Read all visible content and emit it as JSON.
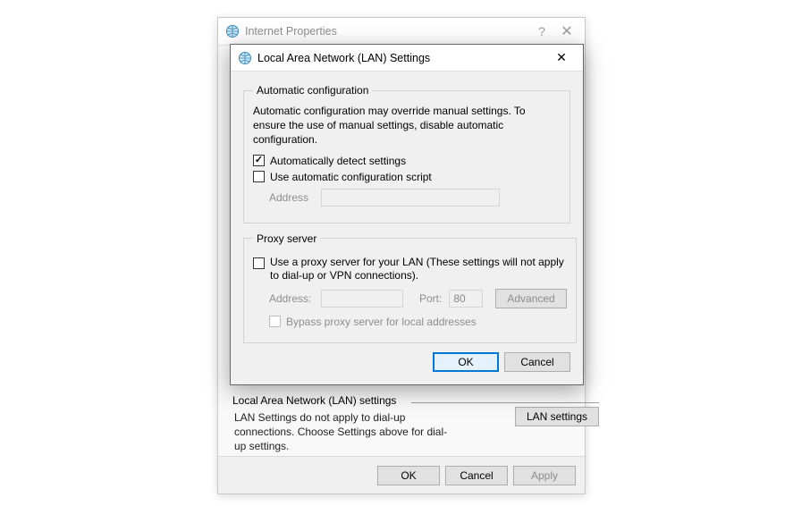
{
  "parent": {
    "title": "Internet Properties",
    "help_glyph": "?",
    "close_glyph": "✕",
    "footer": {
      "ok": "OK",
      "cancel": "Cancel",
      "apply": "Apply"
    },
    "lan_section": {
      "legend": "Local Area Network (LAN) settings",
      "desc": "LAN Settings do not apply to dial-up connections. Choose Settings above for dial-up settings.",
      "button": "LAN settings"
    }
  },
  "dialog": {
    "title": "Local Area Network (LAN) Settings",
    "close_glyph": "✕",
    "auto": {
      "legend": "Automatic configuration",
      "desc": "Automatic configuration may override manual settings.  To ensure the use of manual settings, disable automatic configuration.",
      "detect_label": "Automatically detect settings",
      "detect_checked": true,
      "script_label": "Use automatic configuration script",
      "script_checked": false,
      "address_label": "Address",
      "address_value": ""
    },
    "proxy": {
      "legend": "Proxy server",
      "use_label": "Use a proxy server for your LAN (These settings will not apply to dial-up or VPN connections).",
      "use_checked": false,
      "address_label": "Address:",
      "address_value": "",
      "port_label": "Port:",
      "port_value": "80",
      "advanced": "Advanced",
      "bypass_label": "Bypass proxy server for local addresses",
      "bypass_checked": false
    },
    "footer": {
      "ok": "OK",
      "cancel": "Cancel"
    }
  }
}
